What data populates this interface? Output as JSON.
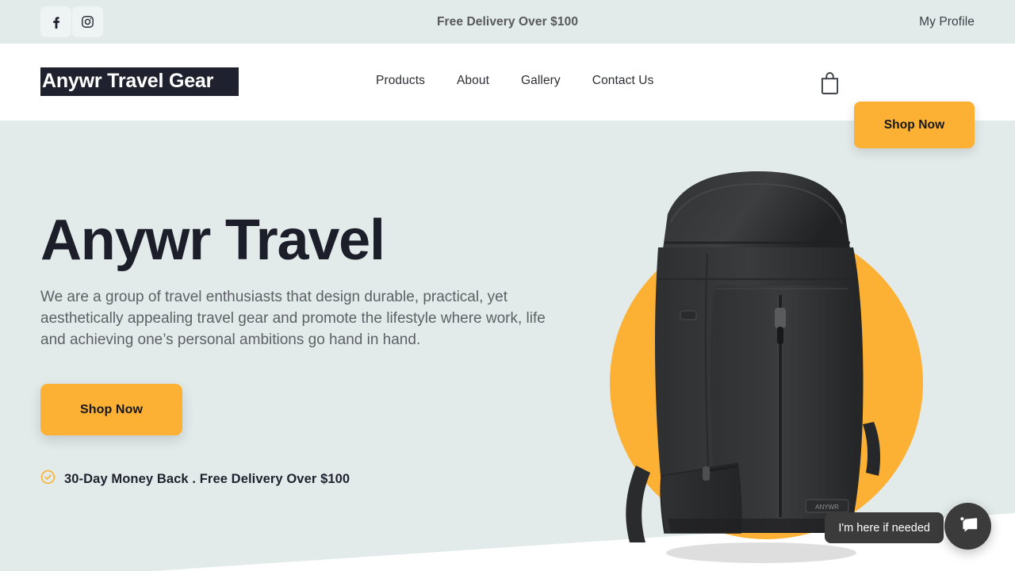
{
  "topbar": {
    "social": [
      {
        "name": "facebook-icon",
        "label": "Facebook"
      },
      {
        "name": "instagram-icon",
        "label": "Instagram"
      }
    ],
    "promo_message": "Free Delivery Over $100",
    "profile_label": "My Profile"
  },
  "header": {
    "logo_text": "Anywr Travel Gear",
    "nav": [
      {
        "label": "Products"
      },
      {
        "label": "About"
      },
      {
        "label": "Gallery"
      },
      {
        "label": "Contact Us"
      }
    ],
    "cart_icon": "shopping-bag-icon",
    "shop_button_label": "Shop Now"
  },
  "hero": {
    "title": "Anywr Travel",
    "paragraph": "We are a group of travel enthusiasts that design durable, practical, yet aesthetically appealing travel gear and promote the lifestyle where work, life and achieving one’s personal ambitions go hand in hand.",
    "shop_button_label": "Shop Now",
    "guarantee_icon": "check-circle-icon",
    "guarantee_text": "30-Day Money Back . Free Delivery Over $100",
    "product_image_alt": "black-travel-backpack"
  },
  "chat": {
    "tooltip_text": "I'm here if needed",
    "button_icon": "chat-bubble-icon"
  },
  "colors": {
    "accent_orange": "#fcb034",
    "hero_background": "#e2ebea",
    "topbar_background": "#e2ebea",
    "dark_navy": "#1c1f2a",
    "chat_dark": "#3b3b3b",
    "body_text": "#5d6166"
  }
}
